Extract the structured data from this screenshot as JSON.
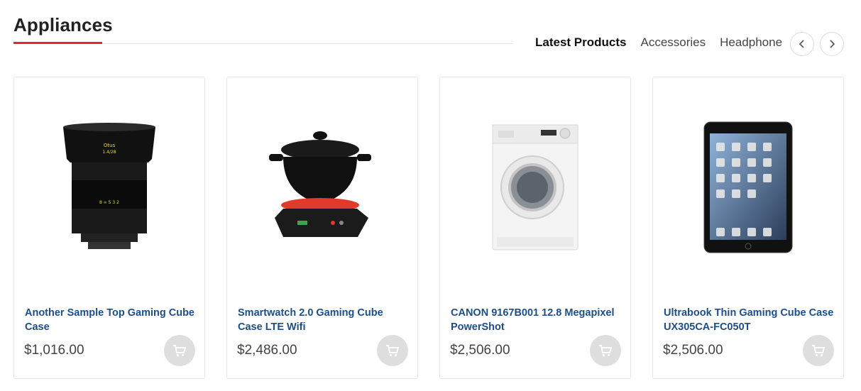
{
  "section": {
    "title": "Appliances"
  },
  "tabs": [
    {
      "label": "Latest Products",
      "active": true
    },
    {
      "label": "Accessories",
      "active": false
    },
    {
      "label": "Headphone",
      "active": false
    }
  ],
  "nav": {
    "prev_icon": "chevron-left-icon",
    "next_icon": "chevron-right-icon"
  },
  "colors": {
    "accent": "#e02b2b",
    "product_link": "#1d4e89",
    "cart_button": "#dedede"
  },
  "products": [
    {
      "name": "Another Sample Top Gaming Cube Case",
      "price": "$1,016.00",
      "image": "camera-lens"
    },
    {
      "name": "Smartwatch 2.0 Gaming Cube Case LTE Wifi",
      "price": "$2,486.00",
      "image": "electric-cooker"
    },
    {
      "name": "CANON 9167B001 12.8 Megapixel PowerShot",
      "price": "$2,506.00",
      "image": "washing-machine"
    },
    {
      "name": "Ultrabook Thin Gaming Cube Case UX305CA-FC050T",
      "price": "$2,506.00",
      "image": "tablet"
    }
  ]
}
